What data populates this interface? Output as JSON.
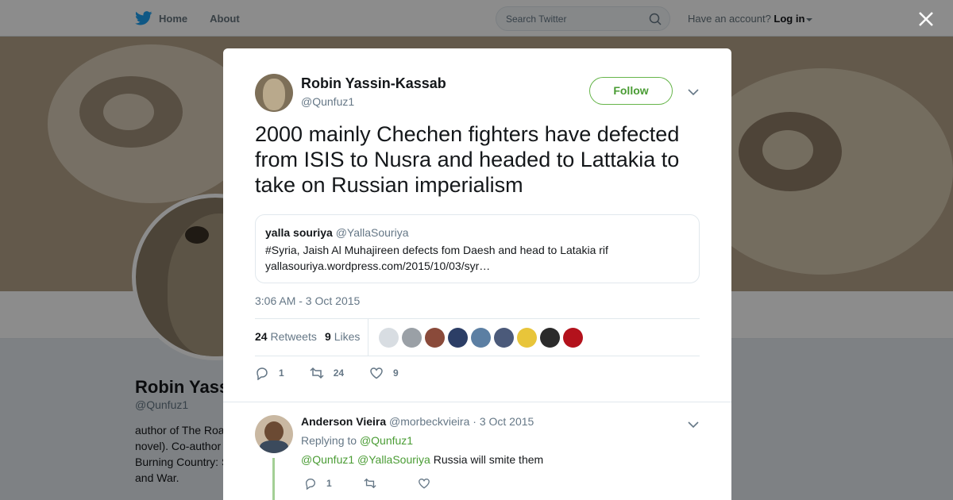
{
  "nav": {
    "home_label": "Home",
    "about_label": "About",
    "search_placeholder": "Search Twitter",
    "account_prompt": "Have an account?",
    "login_label": "Log in"
  },
  "profile": {
    "name": "Robin Yass",
    "handle": "@Qunfuz1",
    "bio_lines": [
      "author of The Roa",
      "novel). Co-author",
      "Burning Country: S",
      "and War."
    ]
  },
  "tweet": {
    "author_name": "Robin Yassin-Kassab",
    "author_handle": "@Qunfuz1",
    "follow_label": "Follow",
    "text": "2000 mainly Chechen fighters have defected from ISIS to Nusra and headed to Lattakia to take on Russian imperialism",
    "quote": {
      "name": "yalla souriya",
      "handle": "@YallaSouriya",
      "line1": "#Syria, Jaish Al Muhajireen defects fom Daesh and head to Latakia rif",
      "line2": "yallasouriya.wordpress.com/2015/10/03/syr…"
    },
    "timestamp": "3:06 AM - 3 Oct 2015",
    "retweets_count": "24",
    "retweets_label": "Retweets",
    "likes_count": "9",
    "likes_label": "Likes",
    "liker_colors": [
      "#d8dde2",
      "#9aa0a6",
      "#8a4a3a",
      "#2c3e66",
      "#5c7fa3",
      "#4b5a7a",
      "#e8c53a",
      "#2b2b2b",
      "#b3121c"
    ],
    "reply_count": "1",
    "retweet_count": "24",
    "like_count": "9"
  },
  "reply": {
    "name": "Anderson Vieira",
    "handle": "@morbeckvieira",
    "date": "· 3 Oct 2015",
    "replying_label": "Replying to",
    "replying_to": "@Qunfuz1",
    "mention1": "@Qunfuz1",
    "mention2": "@YallaSouriya",
    "text": "Russia will smite them",
    "reply_count": "1"
  },
  "colors": {
    "accent_green": "#4a9c34",
    "text_secondary": "#657786",
    "bird_blue": "#1da1f2"
  }
}
